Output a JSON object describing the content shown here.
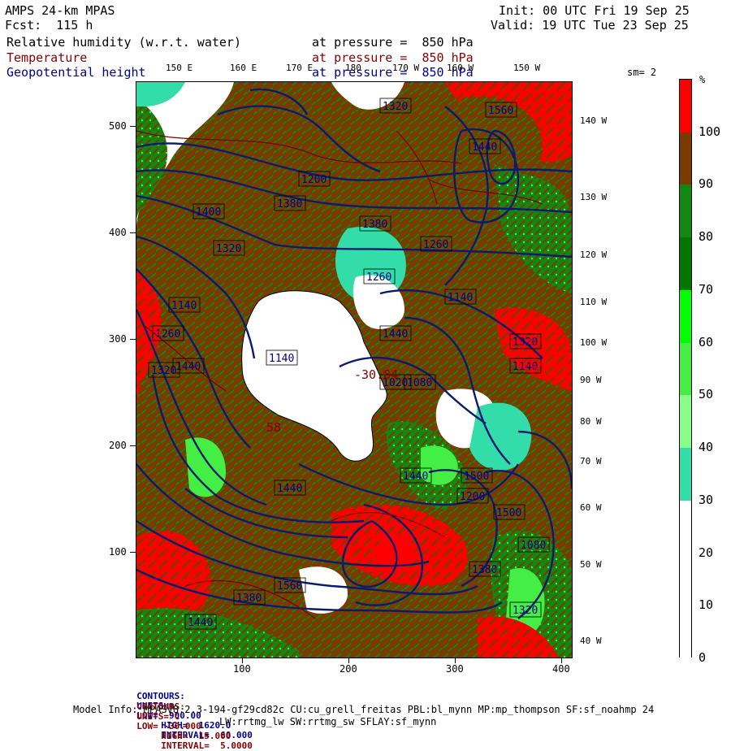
{
  "header": {
    "model": "AMPS 24-km MPAS",
    "forecast": "Fcst:  115 h",
    "init": "Init: 00 UTC Fri 19 Sep 25",
    "valid": "Valid: 19 UTC Tue 23 Sep 25",
    "field1": "Relative humidity (w.r.t. water)",
    "field2": "Temperature",
    "field3": "Geopotential height",
    "pressure1": "at pressure =  850 hPa",
    "pressure2": "at pressure =  850 hPa",
    "pressure3": "at pressure =  850 hPa",
    "smoothing": "sm= 2"
  },
  "colors": {
    "temperature_text": "#8b0000",
    "height_text": "#00008b",
    "height_contour": "#0a1a6e",
    "temp_contour": "#7a0000"
  },
  "footer": {
    "line1_label": "CONTOURS:",
    "line1_units": "UNITS=m",
    "line1_low": "LOW=  900.00",
    "line1_high": "HIGH=  1620.0",
    "line1_interval": "INTERVAL=  60.000",
    "line2_label": "CONTOURS:",
    "line2_units": "UNITS=°C",
    "line2_low": "LOW= -30.000",
    "line2_high": "HIGH=  15.000",
    "line2_interval": "INTERVAL=  5.0000",
    "model_info": "Model Info: MPASv8.2.3-194-gf29cd82c CU:cu_grell_freitas PBL:bl_mynn MP:mp_thompson SF:sf_noahmp 24",
    "model_info2": "LW:rrtmg_lw SW:rrtmg_sw SFLAY:sf_mynn"
  },
  "chart_data": {
    "type": "heatmap",
    "title": "Relative humidity (w.r.t. water)",
    "x_ticks": [
      100,
      200,
      300,
      400
    ],
    "y_ticks": [
      100,
      200,
      300,
      400,
      500
    ],
    "top_longitude_labels": [
      "150 E",
      "160 E",
      "170 E",
      "180",
      "170 W",
      "160 W",
      "150 W"
    ],
    "right_longitude_labels": [
      "140 W",
      "130 W",
      "120 W",
      "110 W",
      "100 W",
      "90 W",
      "80 W",
      "70 W",
      "60 W",
      "50 W",
      "40 W"
    ],
    "colorbar": {
      "unit": "%",
      "ticks": [
        0,
        10,
        20,
        30,
        40,
        50,
        60,
        70,
        80,
        90,
        100
      ],
      "bins": [
        {
          "from": 0,
          "to": 30,
          "color": "#ffffff"
        },
        {
          "from": 30,
          "to": 40,
          "color": "#33ddaa"
        },
        {
          "from": 40,
          "to": 50,
          "color": "#88ff88"
        },
        {
          "from": 50,
          "to": 60,
          "color": "#44ee44"
        },
        {
          "from": 60,
          "to": 70,
          "color": "#00ff00"
        },
        {
          "from": 70,
          "to": 80,
          "color": "#007700"
        },
        {
          "from": 80,
          "to": 90,
          "color": "#118811"
        },
        {
          "from": 90,
          "to": 100,
          "color": "#7a3a00"
        },
        {
          "from": 100,
          "to": 110,
          "color": "#ff0000"
        }
      ]
    },
    "height_labels": [
      "1320",
      "1560",
      "1440",
      "1400",
      "1380",
      "1200",
      "1380",
      "1260",
      "1140",
      "1320",
      "1260",
      "1440",
      "1140",
      "1320",
      "1260",
      "1440",
      "1140",
      "1320",
      "1140",
      "1020",
      "1080",
      "1440",
      "1560",
      "1440",
      "1500",
      "1500",
      "1080",
      "1200",
      "1380",
      "1320",
      "1380",
      "1440"
    ],
    "temperature_labels": [
      "-30.84",
      "58"
    ]
  }
}
